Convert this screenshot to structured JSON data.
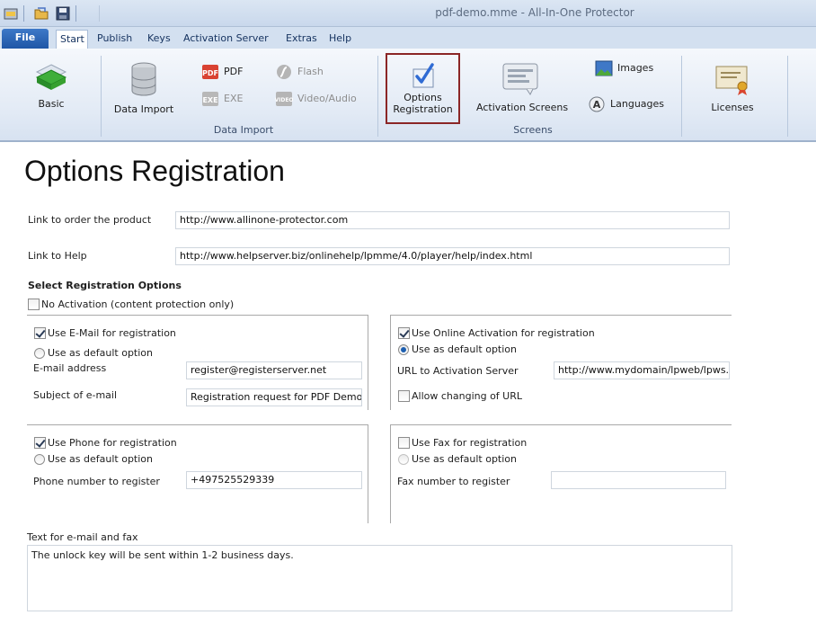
{
  "window": {
    "title": "pdf-demo.mme - All-In-One Protector"
  },
  "tabs": {
    "file": "File",
    "start": "Start",
    "publish": "Publish",
    "keys": "Keys",
    "activation_server": "Activation Server",
    "extras": "Extras",
    "help": "Help"
  },
  "ribbon": {
    "basic": "Basic",
    "data_import": "Data Import",
    "pdf": "PDF",
    "exe": "EXE",
    "flash": "Flash",
    "video_audio": "Video/Audio",
    "group_data_import": "Data Import",
    "options_registration_line1": "Options",
    "options_registration_line2": "Registration",
    "activation_screens": "Activation Screens",
    "images": "Images",
    "languages": "Languages",
    "group_screens": "Screens",
    "licenses": "Licenses"
  },
  "page": {
    "title": "Options Registration",
    "link_order_label": "Link to order the product",
    "link_order_value": "http://www.allinone-protector.com",
    "link_help_label": "Link to Help",
    "link_help_value": "http://www.helpserver.biz/onlinehelp/lpmme/4.0/player/help/index.html",
    "select_header": "Select Registration Options",
    "no_activation": "No Activation (content protection only)",
    "email": {
      "use": "Use E-Mail for registration",
      "default": "Use as default option",
      "address_label": "E-mail address",
      "address_value": "register@registerserver.net",
      "subject_label": "Subject of e-mail",
      "subject_value": "Registration request for PDF  Demo"
    },
    "online": {
      "use": "Use Online Activation for registration",
      "default": "Use as default option",
      "url_label": "URL to Activation Server",
      "url_value": "http://www.mydomain/lpweb/lpws.asmx",
      "allow_change": "Allow changing of URL"
    },
    "phone": {
      "use": "Use Phone for registration",
      "default": "Use as default option",
      "number_label": "Phone number to register",
      "number_value": "+497525529339"
    },
    "fax": {
      "use": "Use Fax for registration",
      "default": "Use as default option",
      "number_label": "Fax number to register",
      "number_value": ""
    },
    "text_label": "Text for e-mail and fax",
    "text_value": "The  unlock key will be sent within 1-2 business days."
  }
}
